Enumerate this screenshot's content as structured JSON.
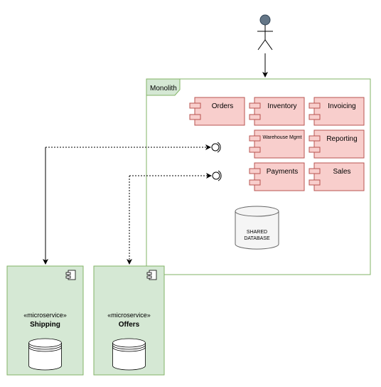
{
  "monolith": {
    "label": "Monolith",
    "components": [
      {
        "name": "Orders"
      },
      {
        "name": "Inventory"
      },
      {
        "name": "Invoicing"
      },
      {
        "name": "Warehouse Mgmt"
      },
      {
        "name": "Reporting"
      },
      {
        "name": "Payments"
      },
      {
        "name": "Sales"
      }
    ],
    "database": {
      "line1": "SHARED",
      "line2": "DATABASE"
    }
  },
  "microservices": [
    {
      "stereotype": "«microservice»",
      "name": "Shipping"
    },
    {
      "stereotype": "«microservice»",
      "name": "Offers"
    }
  ],
  "colors": {
    "monolith_border": "#82b366",
    "microservice_fill": "#d5e8d4",
    "component_fill": "#f8cecc",
    "component_border": "#b85450",
    "database_fill": "#f5f5f5",
    "actor_head": "#647687"
  }
}
